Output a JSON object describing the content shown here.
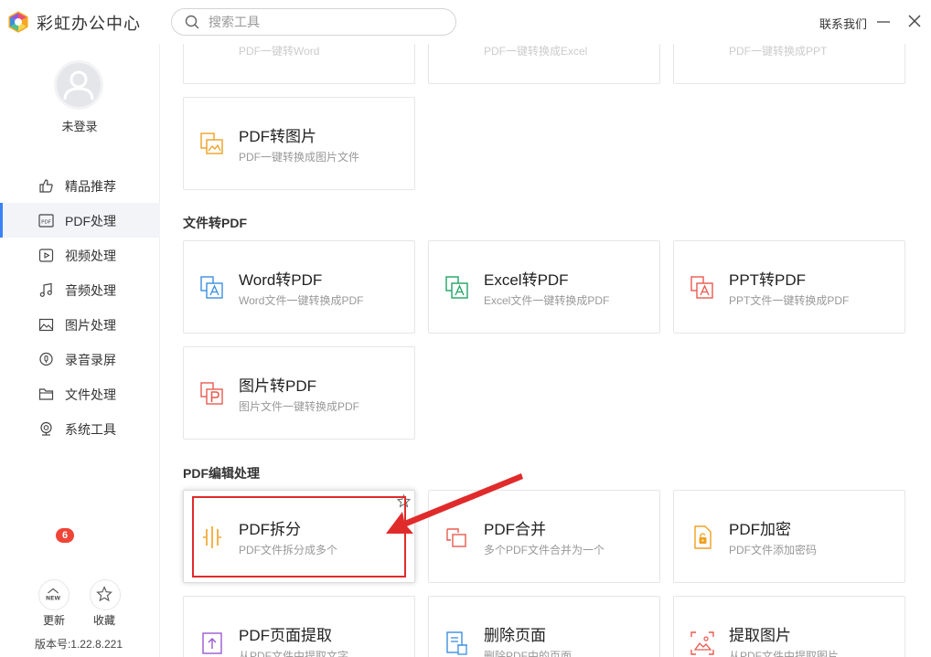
{
  "app": {
    "title": "彩虹办公中心"
  },
  "search": {
    "placeholder": "搜索工具"
  },
  "header": {
    "contact": "联系我们"
  },
  "user": {
    "status": "未登录"
  },
  "sidebar": {
    "items": [
      {
        "label": "精品推荐",
        "icon": "thumbs-up-icon",
        "active": false
      },
      {
        "label": "PDF处理",
        "icon": "pdf-icon",
        "active": true
      },
      {
        "label": "视频处理",
        "icon": "video-icon",
        "active": false
      },
      {
        "label": "音频处理",
        "icon": "music-note-icon",
        "active": false
      },
      {
        "label": "图片处理",
        "icon": "image-icon",
        "active": false
      },
      {
        "label": "录音录屏",
        "icon": "microphone-icon",
        "active": false
      },
      {
        "label": "文件处理",
        "icon": "folder-icon",
        "active": false
      },
      {
        "label": "系统工具",
        "icon": "system-tools-icon",
        "active": false
      }
    ],
    "update_label": "更新",
    "update_badge": "6",
    "update_icon_text": "NEW",
    "favorites_label": "收藏",
    "version": "版本号:1.22.8.221"
  },
  "sections": {
    "top_cards": [
      {
        "desc": "PDF一键转Word"
      },
      {
        "desc": "PDF一键转换成Excel"
      },
      {
        "desc": "PDF一键转换成PPT"
      }
    ],
    "pdf_to_image": {
      "title": "PDF转图片",
      "desc": "PDF一键转换成图片文件"
    },
    "file_to_pdf": {
      "title": "文件转PDF",
      "cards": [
        {
          "title": "Word转PDF",
          "desc": "Word文件一键转换成PDF",
          "icon": "word-to-pdf-icon"
        },
        {
          "title": "Excel转PDF",
          "desc": "Excel文件一键转换成PDF",
          "icon": "excel-to-pdf-icon"
        },
        {
          "title": "PPT转PDF",
          "desc": "PPT文件一键转换成PDF",
          "icon": "ppt-to-pdf-icon"
        },
        {
          "title": "图片转PDF",
          "desc": "图片文件一键转换成PDF",
          "icon": "image-to-pdf-icon"
        }
      ]
    },
    "pdf_edit": {
      "title": "PDF编辑处理",
      "cards": [
        {
          "title": "PDF拆分",
          "desc": "PDF文件拆分成多个",
          "icon": "pdf-split-icon"
        },
        {
          "title": "PDF合并",
          "desc": "多个PDF文件合并为一个",
          "icon": "pdf-merge-icon"
        },
        {
          "title": "PDF加密",
          "desc": "PDF文件添加密码",
          "icon": "pdf-encrypt-icon"
        },
        {
          "title": "PDF页面提取",
          "desc": "从PDF文件中提取文字",
          "icon": "pdf-page-extract-icon"
        },
        {
          "title": "删除页面",
          "desc": "删除PDF中的页面",
          "icon": "delete-page-icon"
        },
        {
          "title": "提取图片",
          "desc": "从PDF文件中提取图片",
          "icon": "extract-image-icon"
        }
      ]
    }
  },
  "colors": {
    "accent": "#3b82f6",
    "annotation": "#e02b2b",
    "badge": "#f04437",
    "pdf_orange": "#f0a020",
    "word_blue": "#3b8fe0",
    "excel_green": "#1fa463",
    "ppt_red": "#e85a4f"
  }
}
